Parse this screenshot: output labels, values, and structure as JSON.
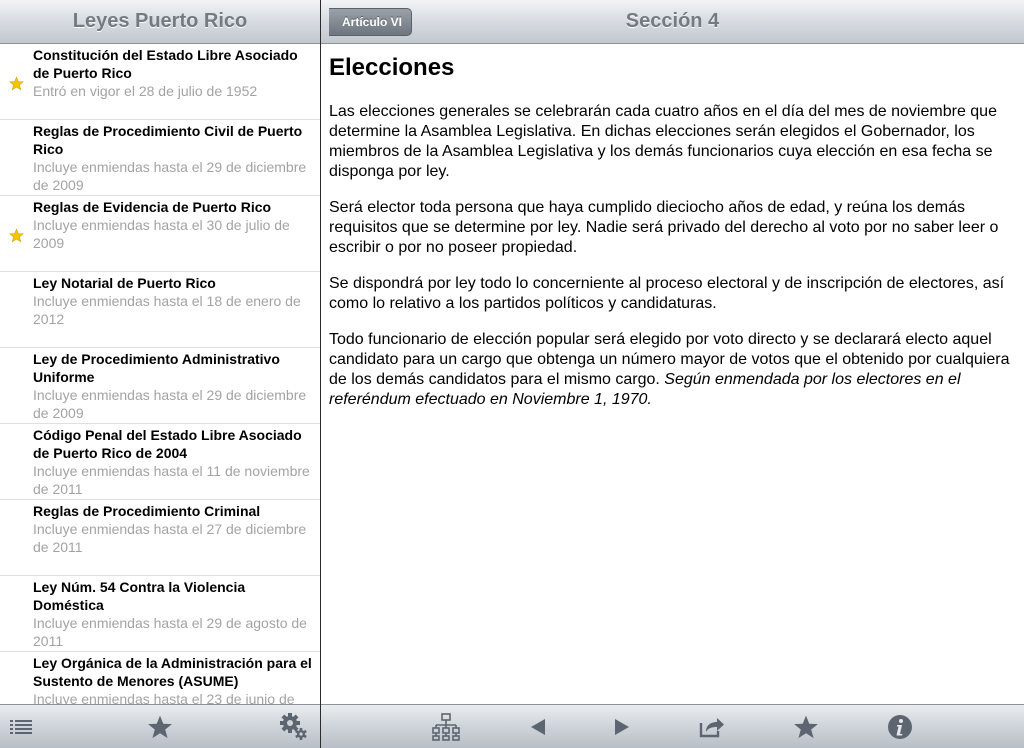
{
  "left_nav": {
    "title": "Leyes Puerto Rico"
  },
  "right_nav": {
    "title": "Sección 4",
    "back_label": "Artículo VI"
  },
  "laws": [
    {
      "title": "Constitución del Estado Libre Asociado de Puerto Rico",
      "subtitle": "Entró en vigor el 28 de julio de 1952",
      "starred": true
    },
    {
      "title": "Reglas de Procedimiento Civil de Puerto Rico",
      "subtitle": "Incluye enmiendas hasta el 29 de diciembre de 2009",
      "starred": false
    },
    {
      "title": "Reglas de Evidencia de Puerto Rico",
      "subtitle": "Incluye enmiendas hasta el 30 de julio de 2009",
      "starred": true
    },
    {
      "title": "Ley Notarial de Puerto Rico",
      "subtitle": "Incluye enmiendas hasta el 18 de enero de 2012",
      "starred": false
    },
    {
      "title": "Ley de Procedimiento Administrativo Uniforme",
      "subtitle": "Incluye enmiendas hasta el 29 de diciembre de 2009",
      "starred": false
    },
    {
      "title": "Código Penal del Estado Libre Asociado de Puerto Rico de 2004",
      "subtitle": "Incluye enmiendas hasta el 11 de noviembre de 2011",
      "starred": false
    },
    {
      "title": "Reglas de Procedimiento Criminal",
      "subtitle": "Incluye enmiendas hasta el 27 de diciembre de 2011",
      "starred": false
    },
    {
      "title": "Ley Núm. 54 Contra la Violencia Doméstica",
      "subtitle": "Incluye enmiendas hasta el 29 de agosto de 2011",
      "starred": false
    },
    {
      "title": "Ley Orgánica de la Administración para el Sustento de Menores (ASUME)",
      "subtitle": "Incluye enmiendas hasta el 23 de junio de",
      "starred": false
    }
  ],
  "content": {
    "heading": "Elecciones",
    "paragraphs": [
      "Las elecciones generales se celebrarán cada cuatro años en el día del mes de noviembre que determine la Asamblea Legislativa. En dichas elecciones serán elegidos el Gobernador, los miembros de la Asamblea Legislativa y los demás funcionarios cuya elección en esa fecha se disponga por ley.",
      "Será elector toda persona que haya cumplido dieciocho años de edad, y reúna los demás requisitos que se determine por ley. Nadie será privado del derecho al voto por no saber leer o escribir o por no poseer propiedad.",
      "Se dispondrá por ley todo lo concerniente al proceso electoral y de inscripción de electores, así como lo relativo a los partidos políticos y candidaturas."
    ],
    "last_paragraph": "Todo funcionario de elección popular será elegido por voto directo y se declarará electo aquel candidato para un cargo que obtenga un número mayor de votos que el obtenido por cualquiera de los demás candidatos para el mismo cargo.",
    "amendment_note": "Según enmendada por los electores en el referéndum efectuado en Noviembre 1, 1970."
  },
  "icons": {
    "left_toolbar": [
      "list-icon",
      "star-icon",
      "gear-icon"
    ],
    "right_toolbar": [
      "hierarchy-icon",
      "previous-arrow-icon",
      "next-arrow-icon",
      "share-icon",
      "star-icon",
      "info-icon"
    ]
  },
  "colors": {
    "star": "#f2c500",
    "toolbar_icon": "#5d6670"
  }
}
